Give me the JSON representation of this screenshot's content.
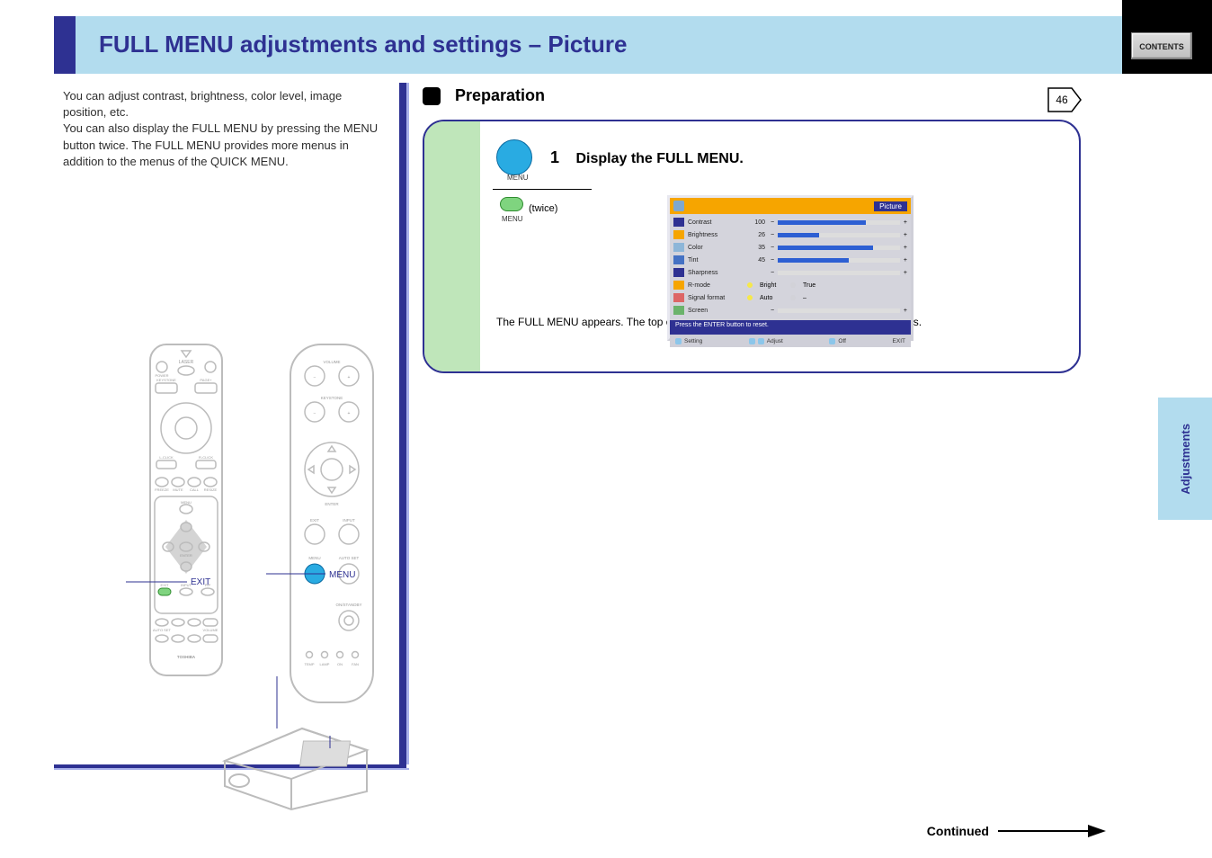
{
  "header": {
    "title": "FULL MENU adjustments and settings – Picture",
    "contents_btn": "CONTENTS",
    "page_number": "46"
  },
  "side_tab": "Adjustments",
  "left": {
    "intro": "You can adjust contrast, brightness, color level, image position, etc.\nYou can also display the FULL MENU by pressing the MENU button twice. The FULL MENU provides more menus in addition to the menus of the QUICK MENU."
  },
  "remote_left": {
    "power_label": "POWER",
    "laser": "LASER",
    "keystone": "KEYSTONE",
    "page_plus": "PAGE+",
    "page_minus": "PAGE–",
    "l_click": "L-CLICK",
    "r_click": "R-CLICK",
    "freeze": "FREEZE",
    "mute": "MUTE",
    "call": "CALL",
    "resize": "RESIZE",
    "menu": "MENU",
    "enter": "ENTER",
    "exit": "EXIT",
    "input": "INPUT",
    "pip": "PIP",
    "auto_set": "AUTO SET",
    "volume": "VOLUME",
    "brand": "TOSHIBA"
  },
  "remote_right": {
    "menu": "MENU",
    "enter": "ENTER",
    "volume": "VOLUME",
    "keystone": "KEYSTONE",
    "exit": "EXIT",
    "input": "INPUT",
    "auto_set": "AUTO SET",
    "on_standby": "ON/STANDBY",
    "temp": "TEMP",
    "lamp": "LAMP",
    "on": "ON",
    "fan": "FAN"
  },
  "callouts": {
    "menu": "MENU",
    "exit": "EXIT"
  },
  "preparation": {
    "label": "Preparation",
    "step_number": "1",
    "step_text": "Display the FULL MENU.",
    "button_pair_menu": "MENU",
    "inner_label": "MENU",
    "twice_note": "(twice)",
    "footnote": "The FULL MENU appears. The top of the FULL MENU displays icons of the main menus."
  },
  "osd": {
    "tabs": [
      "Picture"
    ],
    "header_title": "Picture",
    "rows": [
      {
        "icon": "contrast",
        "label": "Contrast",
        "value": "100",
        "fill": 72
      },
      {
        "icon": "brightness",
        "label": "Brightness",
        "value": "26",
        "fill": 34
      },
      {
        "icon": "color",
        "label": "Color",
        "value": "35",
        "fill": 78
      },
      {
        "icon": "tint",
        "label": "Tint",
        "value": "45",
        "fill": 58
      },
      {
        "icon": "sharpness",
        "label": "Sharpness",
        "value": "",
        "fill": 0
      },
      {
        "icon": "rmode_bright",
        "label": "R-mode",
        "opt1": "Bright",
        "opt2": "True",
        "sel": 0
      },
      {
        "icon": "signal",
        "label": "Signal format",
        "opt1": "Auto",
        "opt2": "–",
        "sel": 0
      },
      {
        "icon": "screen",
        "label": "Screen",
        "value": "",
        "fill": 0
      }
    ],
    "message": "Press the ENTER button to reset.",
    "bottom": {
      "setting": "Setting",
      "adjust": "Adjust",
      "off": "Off",
      "exit": "EXIT"
    }
  },
  "continued": "Continued"
}
